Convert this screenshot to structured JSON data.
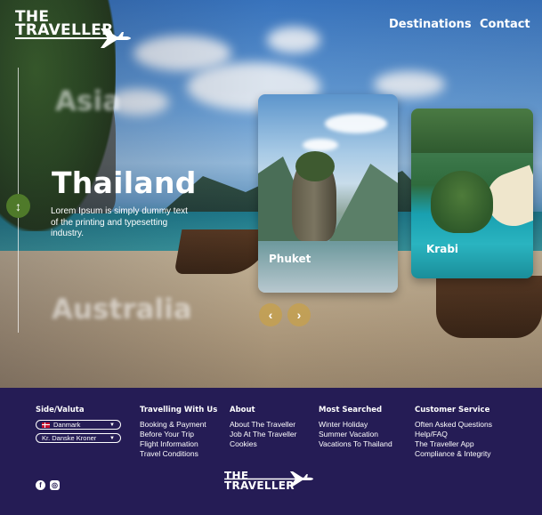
{
  "brand": {
    "line1": "THE",
    "line2": "TRAVELLER"
  },
  "nav": {
    "destinations": "Destinations",
    "contact": "Contact"
  },
  "hero": {
    "ghost_top": "Asia",
    "title": "Thailand",
    "description": "Lorem Ipsum is simply dummy text of the printing and typesetting industry.",
    "ghost_bottom": "Australia",
    "side_icon": "↕"
  },
  "cards": [
    {
      "name": "Phuket"
    },
    {
      "name": "Krabi"
    }
  ],
  "carousel": {
    "prev": "‹",
    "next": "›"
  },
  "footer": {
    "side_valuta": {
      "title": "Side/Valuta",
      "country": "Danmark",
      "currency": "Kr. Danske Kroner"
    },
    "travelling": {
      "title": "Travelling With Us",
      "links": [
        "Booking & Payment",
        "Before Your Trip",
        "Flight Information",
        "Travel Conditions"
      ]
    },
    "about": {
      "title": "About",
      "links": [
        "About The Traveller",
        "Job At The Traveller",
        "Cookies"
      ]
    },
    "most_searched": {
      "title": "Most Searched",
      "links": [
        "Winter Holiday",
        "Summer Vacation",
        "Vacations To Thailand"
      ]
    },
    "customer_service": {
      "title": "Customer Service",
      "links": [
        "Often Asked Questions",
        "Help/FAQ",
        "The Traveller App",
        "Compliance & Integrity"
      ]
    },
    "social": {
      "facebook": "f",
      "instagram": "◎"
    }
  },
  "colors": {
    "footer_bg": "#251c55",
    "accent_gold": "#c4a050",
    "knob_green": "#4f7a2a"
  }
}
